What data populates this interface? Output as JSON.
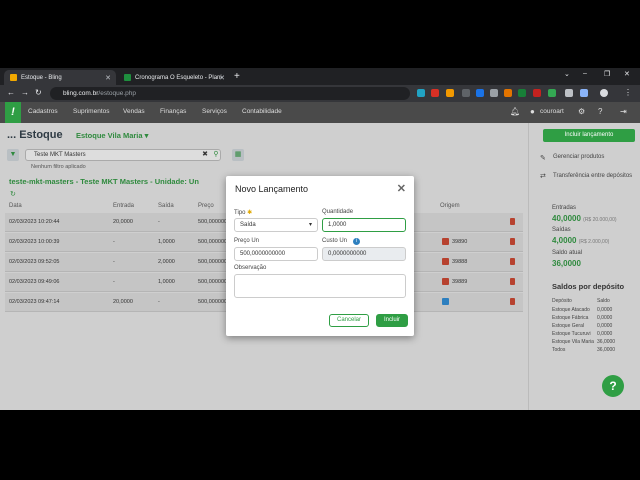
{
  "browser": {
    "tabs": [
      {
        "title": "Estoque - Bling",
        "color": "#f2a900"
      },
      {
        "title": "Cronograma O Esqueleto - Plani",
        "color": "#1e8e3e"
      }
    ],
    "url_host": "bling.com.br",
    "url_path": "/estoque.php",
    "close_glyph": "✕",
    "newtab_glyph": "+"
  },
  "header": {
    "logo": "!",
    "menu": [
      "Cadastros",
      "Suprimentos",
      "Vendas",
      "Finanças",
      "Serviços",
      "Contabilidade"
    ],
    "user": "couroart"
  },
  "page": {
    "title": "... Estoque",
    "warehouse": "Estoque Vila Maria ▾",
    "search_value": "Teste MKT Masters",
    "no_filter": "Nenhum filtro aplicado",
    "product_title": "teste-mkt-masters - Teste MKT Masters - Unidade: Un",
    "columns": [
      "Data",
      "Entrada",
      "Saída",
      "Preço",
      "Origem"
    ],
    "rows": [
      {
        "date": "02/03/2023 10:20:44",
        "entrada": "20,0000",
        "saida": "-",
        "preco": "500,000000",
        "origem": ""
      },
      {
        "date": "02/03/2023 10:00:39",
        "entrada": "-",
        "saida": "1,0000",
        "preco": "500,000000",
        "origem": "39890"
      },
      {
        "date": "02/03/2023 09:52:05",
        "entrada": "-",
        "saida": "2,0000",
        "preco": "500,000000",
        "origem": "39888"
      },
      {
        "date": "02/03/2023 09:49:06",
        "entrada": "-",
        "saida": "1,0000",
        "preco": "500,000000",
        "origem": "39889"
      },
      {
        "date": "02/03/2023 09:47:14",
        "entrada": "20,0000",
        "saida": "-",
        "preco": "500,000000",
        "origem": ""
      }
    ]
  },
  "side": {
    "include_btn": "Incluir lançamento",
    "manage": "Gerenciar produtos",
    "transfer": "Transferência entre depósitos",
    "entradas_label": "Entradas",
    "entradas_value": "40,0000",
    "entradas_sub": "(R$ 20.000,00)",
    "saidas_label": "Saídas",
    "saidas_value": "4,0000",
    "saidas_sub": "(R$ 2.000,00)",
    "saldo_label": "Saldo atual",
    "saldo_value": "36,0000",
    "saldos_title": "Saldos por depósito",
    "dep_header": [
      "Depósito",
      "Saldo"
    ],
    "deps": [
      [
        "Estoque Atacado",
        "0,0000"
      ],
      [
        "Estoque Fábrica",
        "0,0000"
      ],
      [
        "Estoque Geral",
        "0,0000"
      ],
      [
        "Estoque Tucuruvi",
        "0,0000"
      ],
      [
        "Estoque Vila Maria",
        "36,0000"
      ],
      [
        "Todos",
        "36,0000"
      ]
    ]
  },
  "modal": {
    "title": "Novo Lançamento",
    "close": "✕",
    "tipo_label": "Tipo",
    "tipo_value": "Saída",
    "quantidade_label": "Quantidade",
    "quantidade_value": "1,0000",
    "preco_label": "Preço Un",
    "preco_value": "500,0000000000",
    "custo_label": "Custo Un",
    "custo_value": "0,0000000000",
    "obs_label": "Observação",
    "cancel": "Cancelar",
    "ok": "Incluir"
  }
}
